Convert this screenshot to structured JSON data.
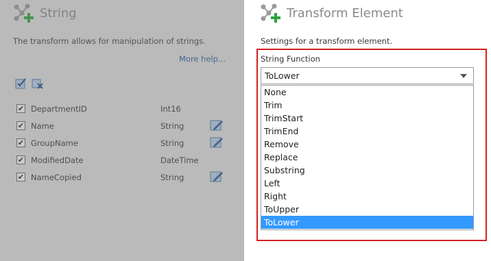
{
  "colors": {
    "accent": "#3399ff",
    "highlight": "#d32020",
    "link": "#2a5a9a",
    "icon_green": "#2aa43c"
  },
  "left_panel": {
    "title": "String",
    "title_icon": "transform-plus-icon",
    "description": "The transform allows for manipulation of strings.",
    "more_help": "More help...",
    "bulk_actions": [
      "check-all-icon",
      "uncheck-all-icon"
    ],
    "fields": [
      {
        "name": "DepartmentID",
        "type": "Int16",
        "checked": true,
        "editable": false
      },
      {
        "name": "Name",
        "type": "String",
        "checked": true,
        "editable": true
      },
      {
        "name": "GroupName",
        "type": "String",
        "checked": true,
        "editable": true
      },
      {
        "name": "ModifiedDate",
        "type": "DateTime",
        "checked": true,
        "editable": false
      },
      {
        "name": "NameCopied",
        "type": "String",
        "checked": true,
        "editable": true
      }
    ]
  },
  "right_panel": {
    "title": "Transform Element",
    "title_icon": "transform-plus-icon",
    "description": "Settings for a transform element.",
    "string_function": {
      "label": "String Function",
      "selected": "ToLower",
      "options": [
        "None",
        "Trim",
        "TrimStart",
        "TrimEnd",
        "Remove",
        "Replace",
        "Substring",
        "Left",
        "Right",
        "ToUpper",
        "ToLower"
      ]
    }
  }
}
